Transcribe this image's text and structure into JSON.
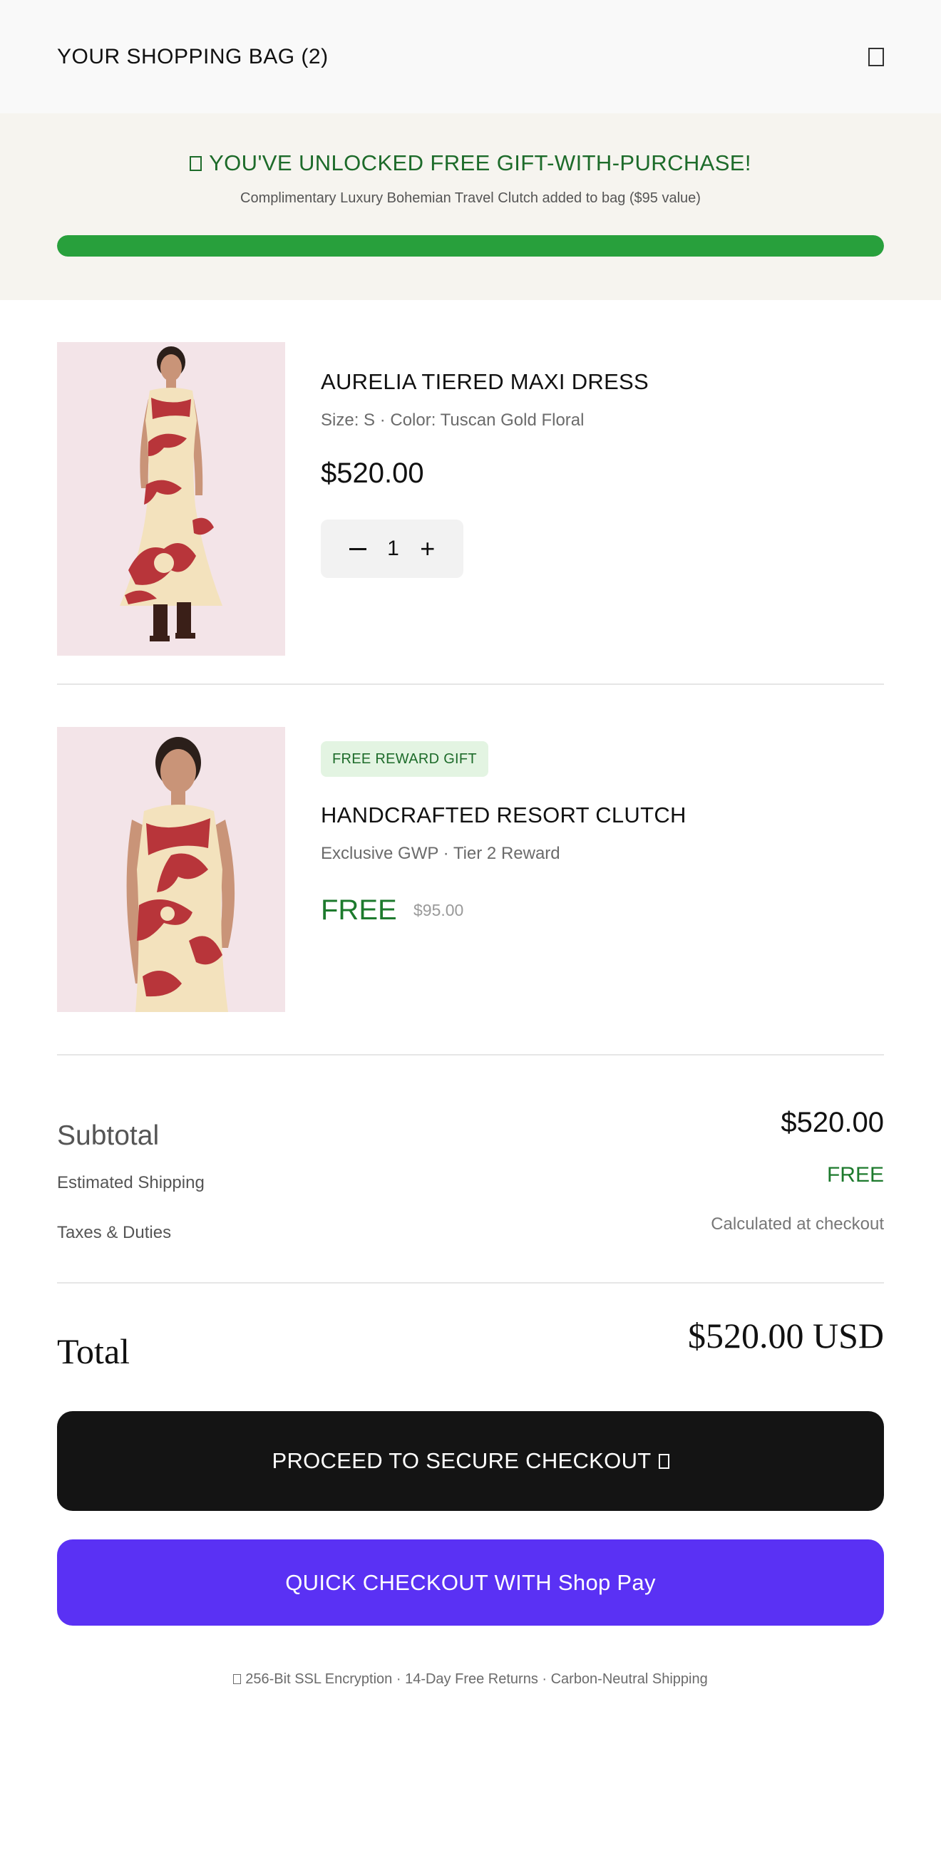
{
  "header": {
    "title": "YOUR SHOPPING BAG (2)",
    "close_icon": "close-icon"
  },
  "promo": {
    "icon": "gift-icon",
    "title": "YOU'VE UNLOCKED FREE GIFT-WITH-PURCHASE!",
    "subtitle": "Complimentary Luxury Bohemian Travel Clutch added to bag ($95 value)",
    "progress": 1.0,
    "progress_color": "#28a03c"
  },
  "items": [
    {
      "name": "AURELIA TIERED MAXI DRESS",
      "meta": "Size: S · Color: Tuscan Gold Floral",
      "price": "$520.00",
      "quantity": "1",
      "image": "model-floral-maxi-dress"
    },
    {
      "badge": "FREE REWARD GIFT",
      "name": "HANDCRAFTED RESORT CLUTCH",
      "meta": "Exclusive GWP · Tier 2 Reward",
      "price": "FREE",
      "original_price": "$95.00",
      "image": "model-floral-dress-closeup"
    }
  ],
  "summary": {
    "subtotal_label": "Subtotal",
    "subtotal_value": "$520.00",
    "shipping_label": "Estimated Shipping",
    "shipping_value": "FREE",
    "taxes_label": "Taxes & Duties",
    "taxes_value": "Calculated at checkout"
  },
  "total": {
    "label": "Total",
    "value": "$520.00 USD"
  },
  "buttons": {
    "checkout_label": "PROCEED TO SECURE CHECKOUT",
    "checkout_icon": "lock-icon",
    "shoppay_label": "QUICK CHECKOUT WITH",
    "shoppay_brand": "Shop Pay"
  },
  "footer": {
    "icon": "shield-icon",
    "text": "256-Bit SSL Encryption · 14-Day Free Returns · Carbon-Neutral Shipping"
  },
  "colors": {
    "accent_green": "#1d6b2a",
    "progress_green": "#28a03c",
    "checkout_black": "#141414",
    "shoppay_purple": "#5a31f4",
    "dress_red": "#b8353a",
    "dress_cream": "#f3e2bd"
  }
}
